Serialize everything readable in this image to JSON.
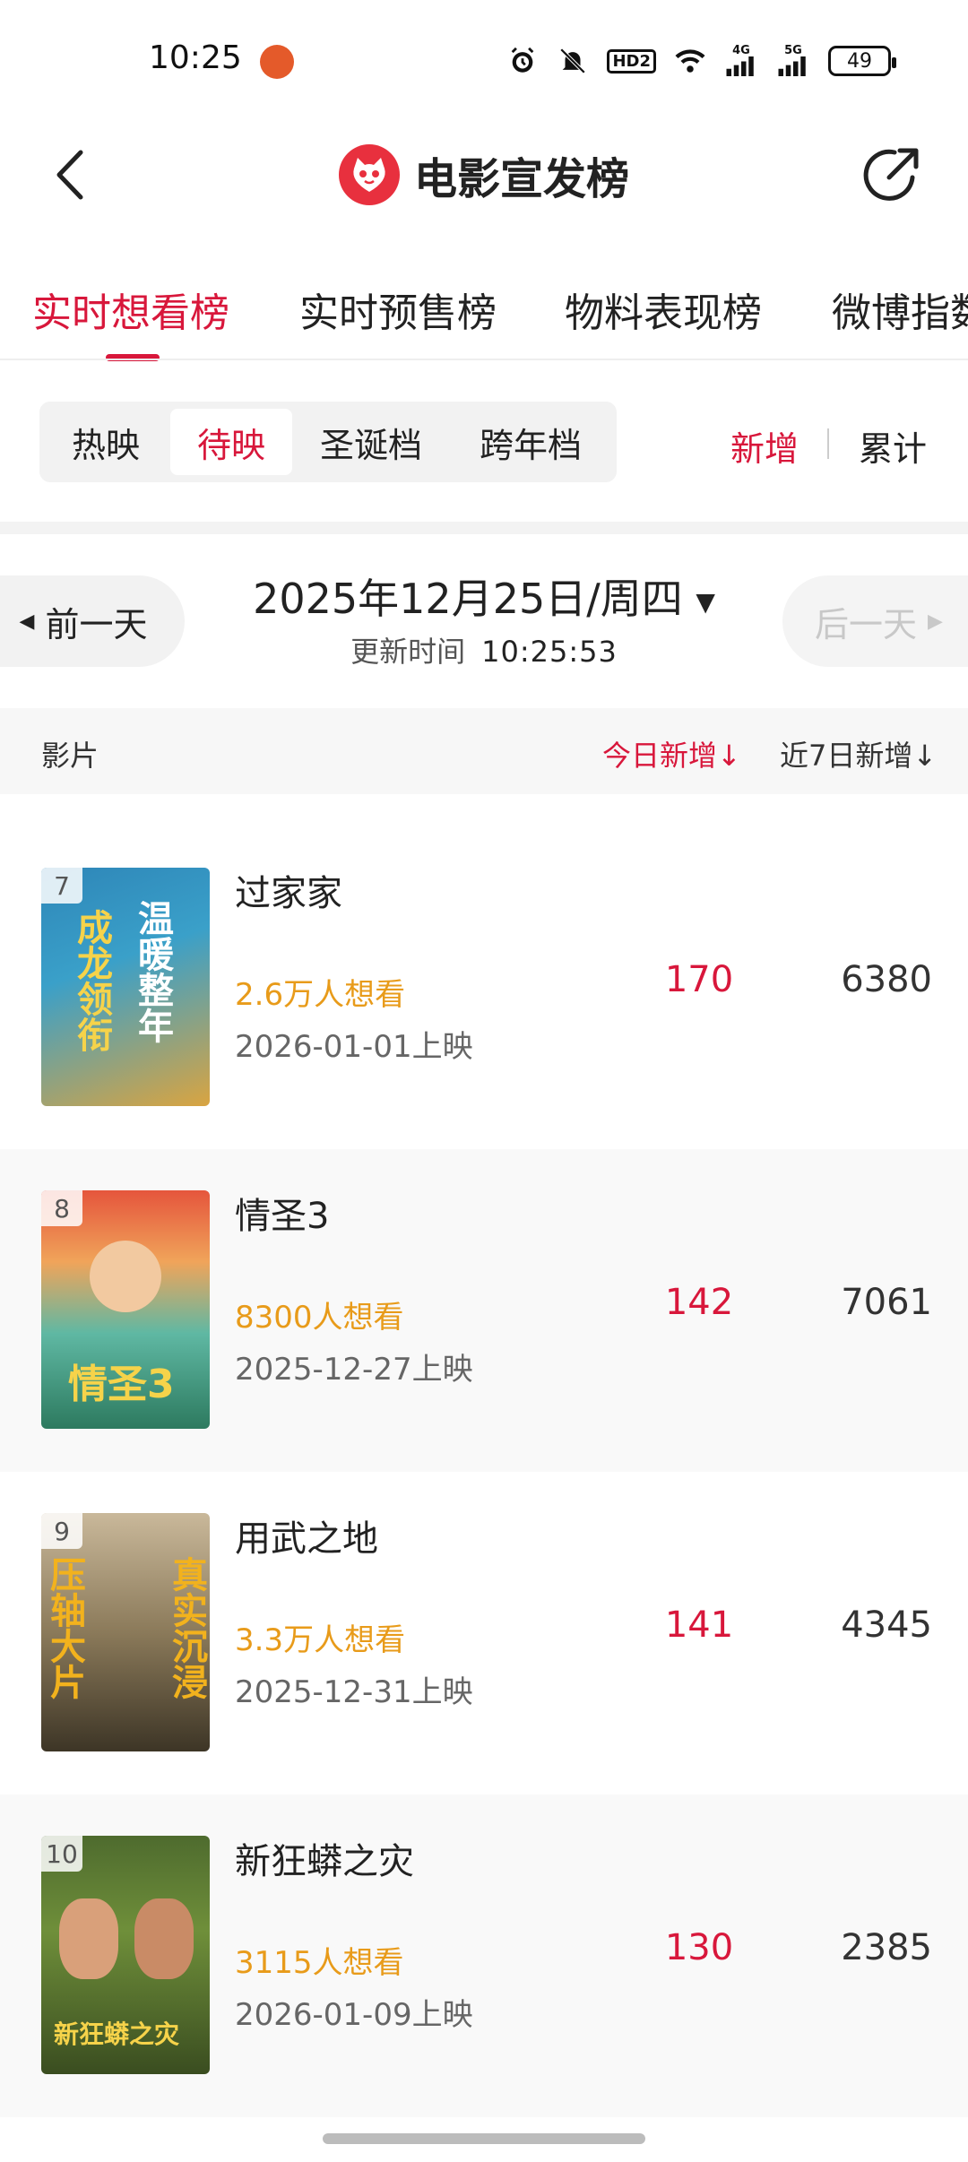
{
  "status_bar": {
    "time": "10:25",
    "hd_label": "HD2",
    "net1": "4G",
    "net2": "5G",
    "battery": "49"
  },
  "header": {
    "title": "电影宣发榜",
    "accent_color": "#d8173b"
  },
  "tabs": [
    {
      "label": "实时想看榜",
      "active": true
    },
    {
      "label": "实时预售榜",
      "active": false
    },
    {
      "label": "物料表现榜",
      "active": false
    },
    {
      "label": "微博指数",
      "active": false
    }
  ],
  "segments": [
    {
      "label": "热映",
      "active": false
    },
    {
      "label": "待映",
      "active": true
    },
    {
      "label": "圣诞档",
      "active": false
    },
    {
      "label": "跨年档",
      "active": false
    }
  ],
  "mode": {
    "new": "新增",
    "total": "累计"
  },
  "date_nav": {
    "prev": "前一天",
    "next": "后一天",
    "date": "2025年12月25日/周四",
    "update_label": "更新时间",
    "update_time": "10:25:53"
  },
  "columns": {
    "film": "影片",
    "today": "今日新增↓",
    "week": "近7日新增↓"
  },
  "films": [
    {
      "rank": "7",
      "name": "过家家",
      "want": "2.6万人想看",
      "release": "2026-01-01上映",
      "today": "170",
      "week": "6380",
      "poster_text_a": "成龙领衔",
      "poster_text_b": "温暖整年"
    },
    {
      "rank": "8",
      "name": "情圣3",
      "want": "8300人想看",
      "release": "2025-12-27上映",
      "today": "142",
      "week": "7061",
      "poster_text_a": "情圣3",
      "poster_text_b": ""
    },
    {
      "rank": "9",
      "name": "用武之地",
      "want": "3.3万人想看",
      "release": "2025-12-31上映",
      "today": "141",
      "week": "4345",
      "poster_text_a": "压轴大片",
      "poster_text_b": "真实沉浸"
    },
    {
      "rank": "10",
      "name": "新狂蟒之灾",
      "want": "3115人想看",
      "release": "2026-01-09上映",
      "today": "130",
      "week": "2385",
      "poster_text_a": "新狂蟒之灾",
      "poster_text_b": ""
    }
  ]
}
